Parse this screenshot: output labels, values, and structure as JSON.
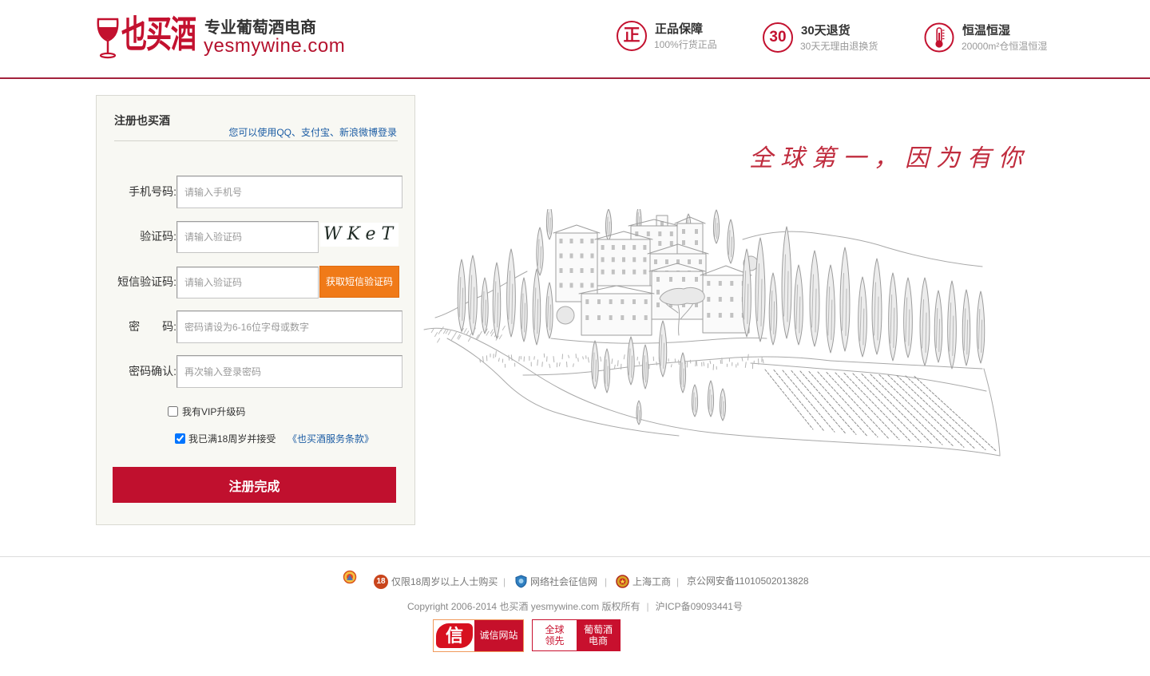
{
  "header": {
    "logo": {
      "icon": "wine-glass-icon",
      "brand_cn": "也买酒",
      "tagline": "专业葡萄酒电商",
      "domain": "yesmywine.com"
    },
    "badges": [
      {
        "icon": "genuine-icon",
        "glyph": "正",
        "title": "正品保障",
        "desc": "100%行货正品"
      },
      {
        "icon": "thirty-days-icon",
        "glyph": "30",
        "title": "30天退货",
        "desc": "30天无理由退换货"
      },
      {
        "icon": "thermometer-icon",
        "title": "恒温恒湿",
        "desc": "20000m²仓恒温恒湿"
      }
    ]
  },
  "register": {
    "title": "注册也买酒",
    "alt_login": "您可以使用QQ、支付宝、新浪微博登录",
    "phone": {
      "label": "手机号码:",
      "placeholder": "请输入手机号"
    },
    "captcha": {
      "label": "验证码:",
      "placeholder": "请输入验证码",
      "image_text": "WKeT"
    },
    "sms": {
      "label": "短信验证码:",
      "placeholder": "请输入验证码",
      "button": "获取短信验证码"
    },
    "password": {
      "label": "密　　码:",
      "placeholder": "密码请设为6-16位字母或数字"
    },
    "confirm": {
      "label": "密码确认:",
      "placeholder": "再次输入登录密码"
    },
    "vip": {
      "label": "我有VIP升级码",
      "checked": false
    },
    "agree": {
      "label": "我已满18周岁并接受",
      "link": "《也买酒服务条款》",
      "checked": true
    },
    "submit": "注册完成"
  },
  "hero": {
    "slogan": "全球第一，因为有你"
  },
  "footer": {
    "separator": "|",
    "links": [
      {
        "icon": "age-18-icon",
        "icon_text": "18",
        "text": "仅限18周岁以上人士购买"
      },
      {
        "icon": "shield-icon",
        "text": "网络社会征信网"
      },
      {
        "icon": "commerce-badge-icon",
        "text": "上海工商"
      },
      {
        "text": "京公网安备11010502013828"
      }
    ],
    "copyright": "Copyright 2006-2014 也买酒 yesmywine.com 版权所有",
    "icp": "沪ICP备09093441号",
    "certificates": [
      {
        "icon_text": "信",
        "text": "诚信网站"
      },
      {
        "left_text": "全球领先",
        "right_text": "葡萄酒电商"
      }
    ]
  },
  "colors": {
    "brand_red": "#c0102e",
    "accent_orange": "#f07a18",
    "link_blue": "#1b5ca4",
    "panel_bg": "#f8f8f3"
  }
}
